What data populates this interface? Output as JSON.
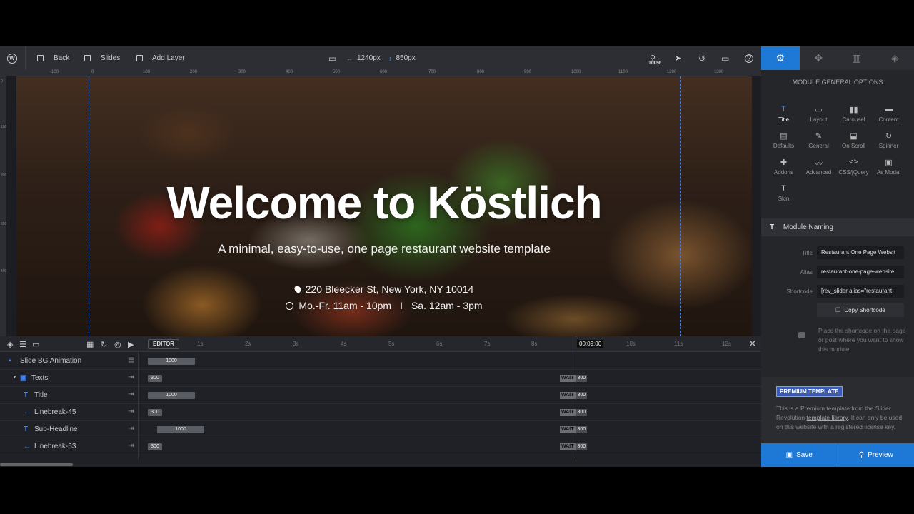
{
  "toolbar": {
    "back_label": "Back",
    "slides_label": "Slides",
    "add_layer_label": "Add Layer",
    "width_value": "1240px",
    "height_value": "850px",
    "zoom_level": "100%"
  },
  "right_tabs": [
    "gear-icon",
    "move-icon",
    "slides-icon",
    "layers-icon"
  ],
  "ruler": {
    "h_ticks": [
      "-100",
      "0",
      "100",
      "200",
      "300",
      "400",
      "500",
      "600",
      "700",
      "800",
      "900",
      "1000",
      "1100",
      "1200",
      "1300"
    ],
    "v_ticks": [
      "0",
      "100",
      "200",
      "300",
      "400"
    ]
  },
  "slide": {
    "title": "Welcome to Köstlich",
    "subtitle": "A minimal, easy-to-use, one page restaurant website template",
    "address": "220 Bleecker St, New York, NY 10014",
    "hours_weekday": "Mo.-Fr. 11am - 10pm",
    "hours_sep": "I",
    "hours_saturday": "Sa. 12am - 3pm"
  },
  "timeline": {
    "editor_label": "EDITOR",
    "current_time": "00:09:00",
    "ticks": [
      "1s",
      "2s",
      "3s",
      "4s",
      "5s",
      "6s",
      "7s",
      "8s",
      "10s",
      "11s",
      "12s"
    ],
    "wait_label": "WAIT",
    "rows": [
      {
        "label": "Slide BG Animation",
        "bar": "1000",
        "wait": ""
      },
      {
        "label": "Texts",
        "bar": "300",
        "wait": "300"
      },
      {
        "label": "Title",
        "bar": "1000",
        "wait": "300"
      },
      {
        "label": "Linebreak-45",
        "bar": "300",
        "wait": "300"
      },
      {
        "label": "Sub-Headline",
        "bar": "1000",
        "wait": "300"
      },
      {
        "label": "Linebreak-53",
        "bar": "300",
        "wait": "300"
      }
    ]
  },
  "panel": {
    "title": "MODULE GENERAL OPTIONS",
    "options": [
      "Title",
      "Layout",
      "Carousel",
      "Content",
      "Defaults",
      "General",
      "On Scroll",
      "Spinner",
      "Addons",
      "Advanced",
      "CSS/jQuery",
      "As Modal",
      "Skin"
    ],
    "naming_header": "Module Naming",
    "title_label": "Title",
    "title_value": "Restaurant One Page Websit",
    "alias_label": "Alias",
    "alias_value": "restaurant-one-page-website",
    "shortcode_label": "Shortcode",
    "shortcode_value": "[rev_slider alias=\"restaurant-",
    "copy_label": "Copy Shortcode",
    "hint": "Place the shortcode on the page or post where you want to show this module.",
    "premium_badge": "PREMIUM TEMPLATE",
    "premium_text_1": "This is a Premium template from the Slider Revolution ",
    "premium_link": "template library",
    "premium_text_2": ". It can only be used on this website with a registered license key."
  },
  "save_label": "Save",
  "preview_label": "Preview",
  "colors": {
    "accent": "#1e78d6",
    "guide": "#3b82f6"
  }
}
